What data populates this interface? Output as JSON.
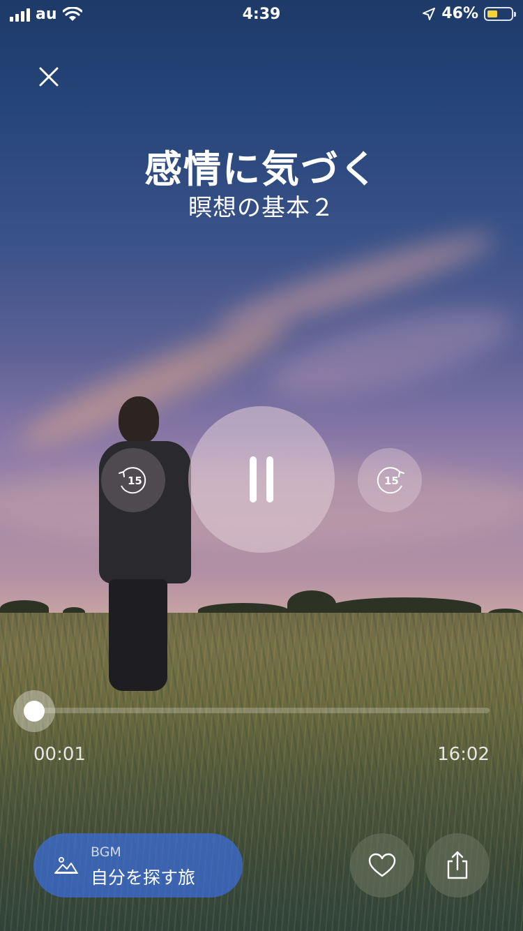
{
  "status_bar": {
    "carrier": "au",
    "time": "4:39",
    "battery_percent": "46%",
    "icons": [
      "signal-icon",
      "wifi-icon",
      "location-icon",
      "battery-icon"
    ]
  },
  "session": {
    "title": "感情に気づく",
    "subtitle": "瞑想の基本２"
  },
  "controls": {
    "rewind_seconds": "15",
    "forward_seconds": "15",
    "state": "playing",
    "icons": [
      "close-icon",
      "pause-icon",
      "rewind-15-icon",
      "forward-15-icon"
    ]
  },
  "progress": {
    "elapsed": "00:01",
    "total": "16:02",
    "fraction": 0.001
  },
  "bgm": {
    "caption": "BGM",
    "title": "自分を探す旅",
    "icon": "landscape-icon"
  },
  "actions": {
    "icons": [
      "heart-icon",
      "share-icon"
    ]
  },
  "colors": {
    "bgm_pill": "#3c6edc",
    "battery_fill": "#f5d13a"
  }
}
